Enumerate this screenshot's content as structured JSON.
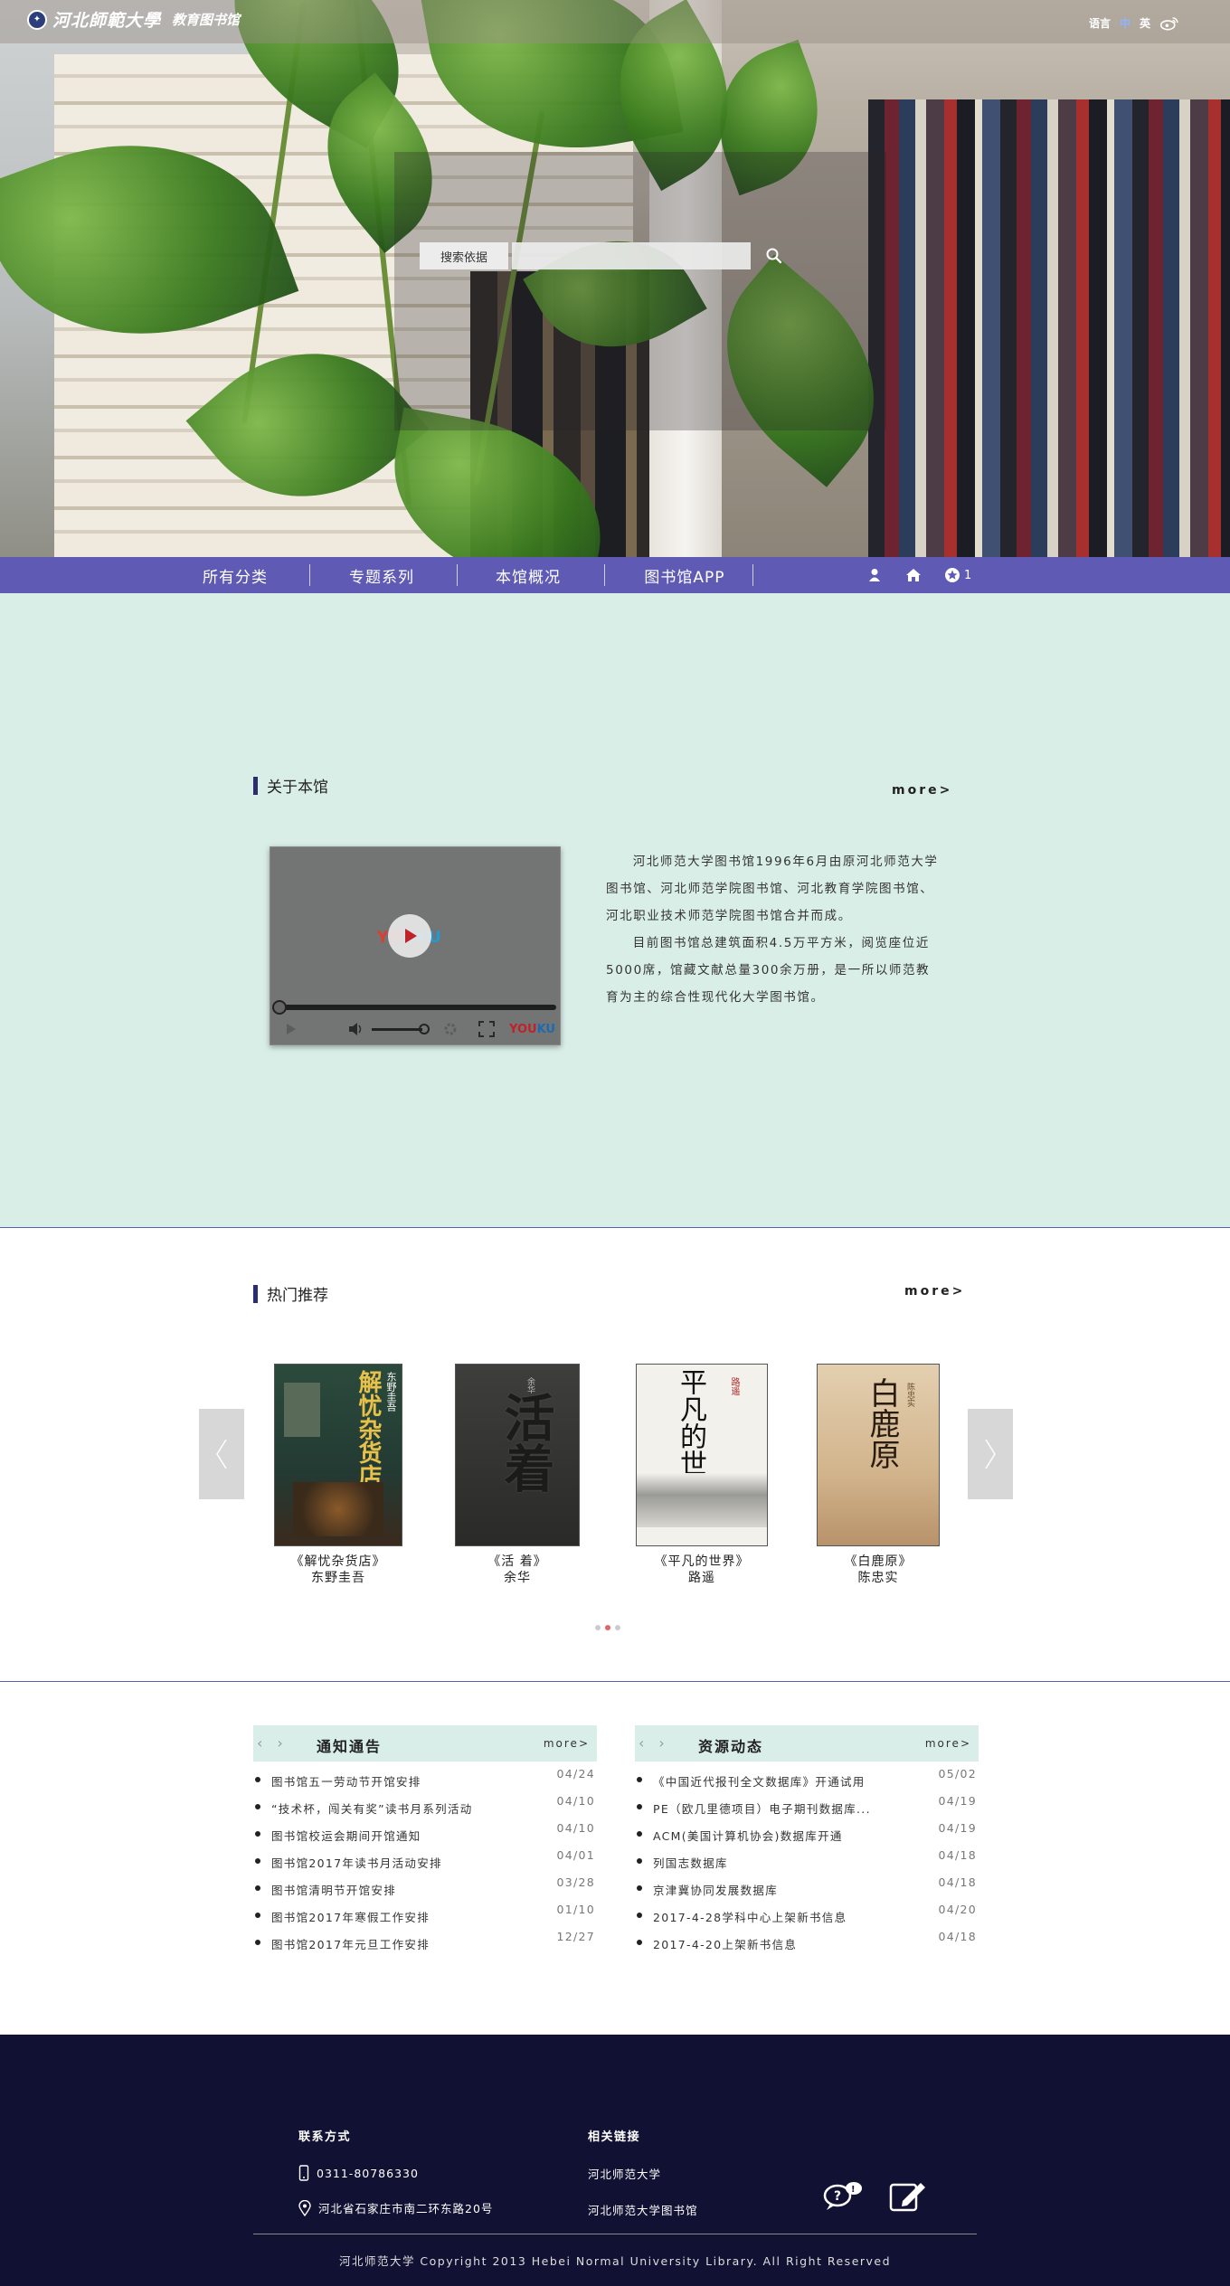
{
  "header": {
    "logo_text": "河北師範大學",
    "logo_sub": "教育图书馆",
    "lang_label": "语言",
    "lang_zh": "中",
    "lang_en": "英",
    "weibo_icon": "weibo-icon"
  },
  "search": {
    "label": "搜索依据",
    "value": "",
    "button_icon": "search-icon"
  },
  "nav": {
    "items": [
      "所有分类",
      "专题系列",
      "本馆概况",
      "图书馆APP"
    ],
    "cart_count": "1",
    "user_icon": "user-icon",
    "home_icon": "home-icon",
    "star_icon": "star-icon"
  },
  "about": {
    "title": "关于本馆",
    "more": "more>",
    "video_logo": "YOUKU",
    "para1": "河北师范大学图书馆1996年6月由原河北师范大学图书馆、河北师范学院图书馆、河北教育学院图书馆、河北职业技术师范学院图书馆合并而成。",
    "para2": "目前图书馆总建筑面积4.5万平方米，阅览座位近5000席，馆藏文献总量300余万册，是一所以师范教育为主的综合性现代化大学图书馆。"
  },
  "hot": {
    "title": "热门推荐",
    "more": "more>",
    "books": [
      {
        "title": "《解忧杂货店》",
        "author": "东野圭吾",
        "cover_text": "解忧杂货店",
        "cover_author": "东野圭吾"
      },
      {
        "title": "《活  着》",
        "author": "余华",
        "cover_text": "活着",
        "cover_author": "余华"
      },
      {
        "title": "《平凡的世界》",
        "author": "路遥",
        "cover_text": "平凡的世界",
        "cover_author": "路遥"
      },
      {
        "title": "《白鹿原》",
        "author": "陈忠实",
        "cover_text": "白鹿原",
        "cover_author": "陈忠实"
      }
    ],
    "active_dot": 1
  },
  "notices": {
    "title": "通知通告",
    "more": "more>",
    "items": [
      {
        "text": "图书馆五一劳动节开馆安排",
        "date": "04/24"
      },
      {
        "text": "“技术杯，闯关有奖”读书月系列活动",
        "date": "04/10"
      },
      {
        "text": "图书馆校运会期间开馆通知",
        "date": "04/10"
      },
      {
        "text": "图书馆2017年读书月活动安排",
        "date": "04/01"
      },
      {
        "text": "图书馆清明节开馆安排",
        "date": "03/28"
      },
      {
        "text": "图书馆2017年寒假工作安排",
        "date": "01/10"
      },
      {
        "text": "图书馆2017年元旦工作安排",
        "date": "12/27"
      }
    ]
  },
  "resources": {
    "title": "资源动态",
    "more": "more>",
    "items": [
      {
        "text": "《中国近代报刊全文数据库》开通试用",
        "date": "05/02"
      },
      {
        "text": "PE（欧几里德项目）电子期刊数据库...",
        "date": "04/19"
      },
      {
        "text": "ACM(美国计算机协会)数据库开通",
        "date": "04/19"
      },
      {
        "text": "列国志数据库",
        "date": "04/18"
      },
      {
        "text": "京津冀协同发展数据库",
        "date": "04/18"
      },
      {
        "text": "2017-4-28学科中心上架新书信息",
        "date": "04/20"
      },
      {
        "text": "2017-4-20上架新书信息",
        "date": "04/18"
      }
    ]
  },
  "footer": {
    "contact_title": "联系方式",
    "phone": "0311-80786330",
    "address": "河北省石家庄市南二环东路20号",
    "links_title": "相关链接",
    "link1": "河北师范大学",
    "link2": "河北师范大学图书馆",
    "copyright": "河北师范大学 Copyright 2013 Hebei Normal University Library. All Right Reserved"
  }
}
